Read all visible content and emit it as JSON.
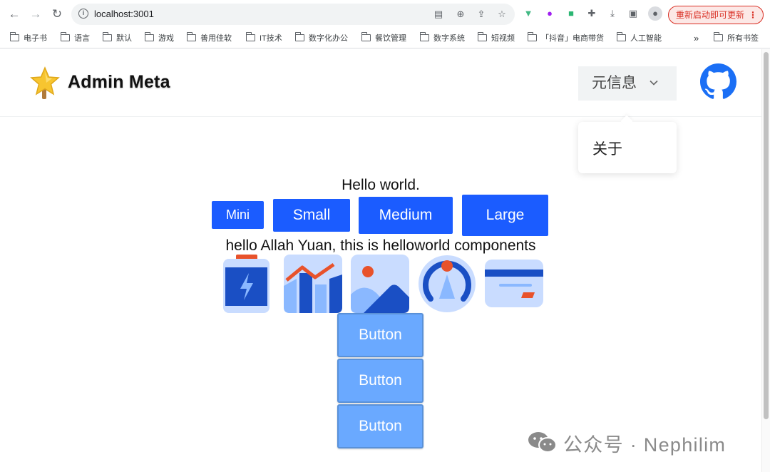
{
  "browser": {
    "url": "localhost:3001",
    "restart_label": "重新启动即可更新",
    "bookmarks": [
      "电子书",
      "语言",
      "默认",
      "游戏",
      "善用佳软",
      "IT技术",
      "数字化办公",
      "餐饮管理",
      "数字系统",
      "短视频",
      "「抖音」电商带货",
      "人工智能"
    ],
    "overflow_label": "»",
    "all_bookmarks_label": "所有书签"
  },
  "header": {
    "title": "Admin Meta",
    "dropdown_label": "元信息",
    "menu_items": [
      "关于"
    ]
  },
  "main": {
    "hello_text": "Hello world.",
    "size_buttons": [
      "Mini",
      "Small",
      "Medium",
      "Large"
    ],
    "greeting_text": "hello Allah Yuan, this is helloworld components",
    "illustrations": [
      "battery-charge-icon",
      "trend-chart-icon",
      "landscape-image-icon",
      "gauge-icon",
      "credit-card-icon"
    ],
    "stack_buttons": [
      "Button",
      "Button",
      "Button"
    ]
  },
  "watermark": {
    "text": "公众号 · Nephilim"
  },
  "colors": {
    "primary_button": "#1b5cff",
    "light_button": "#6aa9ff",
    "accent_red": "#e8522b",
    "icon_blue": "#1a4fc4",
    "icon_light": "#c9dcff"
  }
}
